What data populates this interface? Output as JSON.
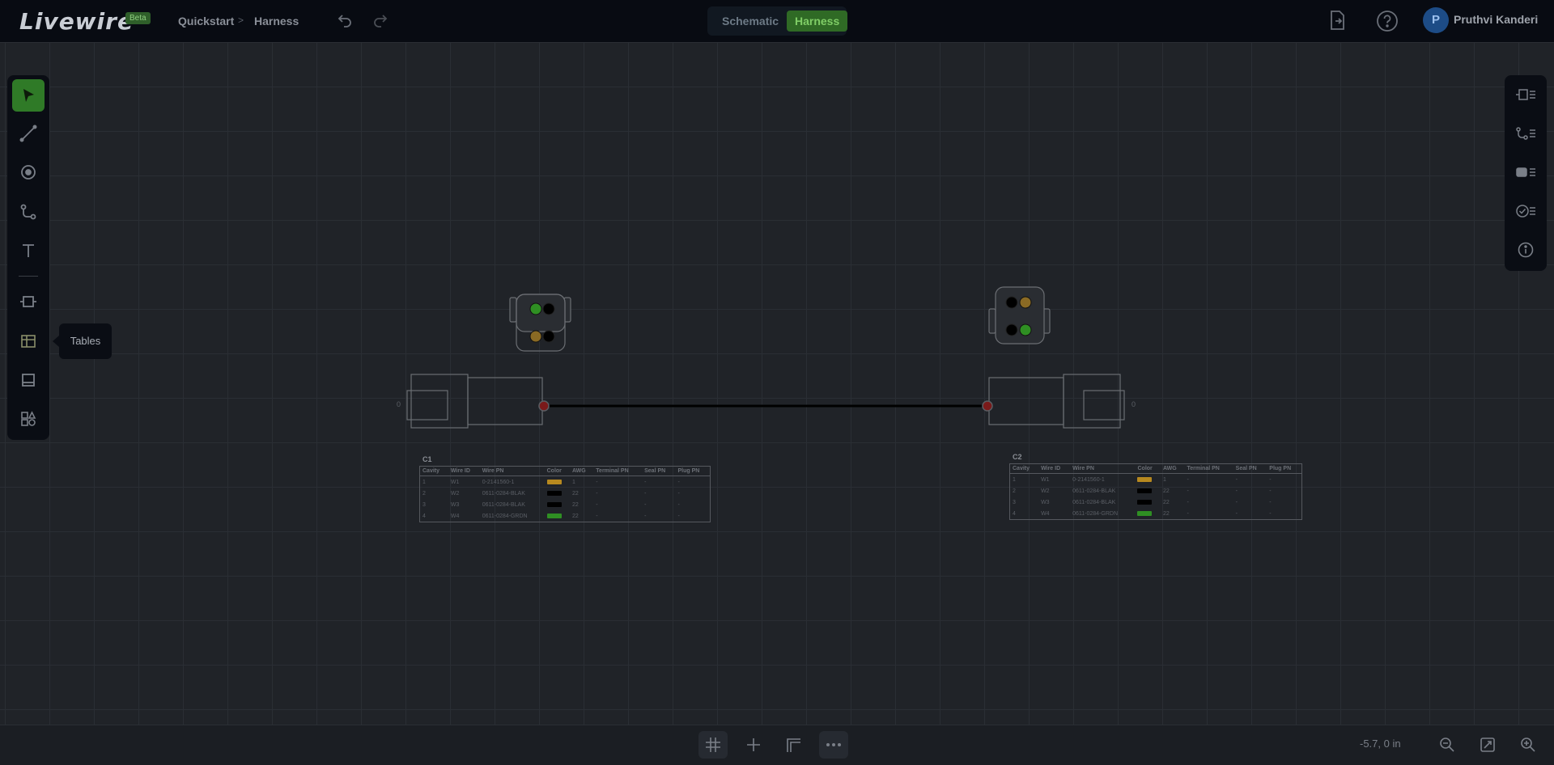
{
  "app": {
    "logo": "Livewire",
    "badge": "Beta"
  },
  "breadcrumb": {
    "project": "Quickstart",
    "separator": ">",
    "page": "Harness"
  },
  "view_toggle": {
    "options": [
      "Schematic",
      "Harness"
    ],
    "selected": "Harness"
  },
  "user": {
    "initial": "P",
    "name": "Pruthvi Kanderi"
  },
  "left_tools": [
    {
      "name": "select",
      "icon": "cursor-icon"
    },
    {
      "name": "wire",
      "icon": "line-icon"
    },
    {
      "name": "node",
      "icon": "target-icon"
    },
    {
      "name": "route",
      "icon": "route-icon"
    },
    {
      "name": "text",
      "icon": "text-icon"
    },
    {
      "name": "connector",
      "icon": "connector-icon"
    },
    {
      "name": "tables",
      "icon": "table-icon"
    },
    {
      "name": "panel",
      "icon": "panel-icon"
    },
    {
      "name": "shapes",
      "icon": "shapes-icon"
    }
  ],
  "tooltip": {
    "label": "Tables"
  },
  "right_tools": [
    "connector-list-icon",
    "wire-list-icon",
    "component-list-icon",
    "checklist-icon",
    "info-icon"
  ],
  "bottom": {
    "coordinates": "-5.7, 0 in"
  },
  "tables": [
    {
      "title": "C1",
      "headers": [
        "Cavity",
        "Wire ID",
        "Wire PN",
        "Color",
        "AWG",
        "Terminal PN",
        "Seal PN",
        "Plug PN"
      ],
      "rows": [
        {
          "cavity": "1",
          "wire_id": "W1",
          "wire_pn": "0-2141560-1",
          "color": "#b7891f",
          "awg": "1",
          "terminal": "-",
          "seal": "-",
          "plug": "-"
        },
        {
          "cavity": "2",
          "wire_id": "W2",
          "wire_pn": "0611-0284-BLAK",
          "color": "#000000",
          "awg": "22",
          "terminal": "-",
          "seal": "-",
          "plug": "-"
        },
        {
          "cavity": "3",
          "wire_id": "W3",
          "wire_pn": "0611-0284-BLAK",
          "color": "#000000",
          "awg": "22",
          "terminal": "-",
          "seal": "-",
          "plug": "-"
        },
        {
          "cavity": "4",
          "wire_id": "W4",
          "wire_pn": "0611-0284-GRDN",
          "color": "#2f8f23",
          "awg": "22",
          "terminal": "-",
          "seal": "-",
          "plug": "-"
        }
      ]
    },
    {
      "title": "C2",
      "headers": [
        "Cavity",
        "Wire ID",
        "Wire PN",
        "Color",
        "AWG",
        "Terminal PN",
        "Seal PN",
        "Plug PN"
      ],
      "rows": [
        {
          "cavity": "1",
          "wire_id": "W1",
          "wire_pn": "0-2141560-1",
          "color": "#b7891f",
          "awg": "1",
          "terminal": "-",
          "seal": "-",
          "plug": "-"
        },
        {
          "cavity": "2",
          "wire_id": "W2",
          "wire_pn": "0611-0284-BLAK",
          "color": "#000000",
          "awg": "22",
          "terminal": "-",
          "seal": "-",
          "plug": "-"
        },
        {
          "cavity": "3",
          "wire_id": "W3",
          "wire_pn": "0611-0284-BLAK",
          "color": "#000000",
          "awg": "22",
          "terminal": "-",
          "seal": "-",
          "plug": "-"
        },
        {
          "cavity": "4",
          "wire_id": "W4",
          "wire_pn": "0611-0284-GRDN",
          "color": "#2f8f23",
          "awg": "22",
          "terminal": "-",
          "seal": "-",
          "plug": "-"
        }
      ]
    }
  ],
  "connector_labels": {
    "left_pin": "0",
    "right_pin": "0"
  }
}
